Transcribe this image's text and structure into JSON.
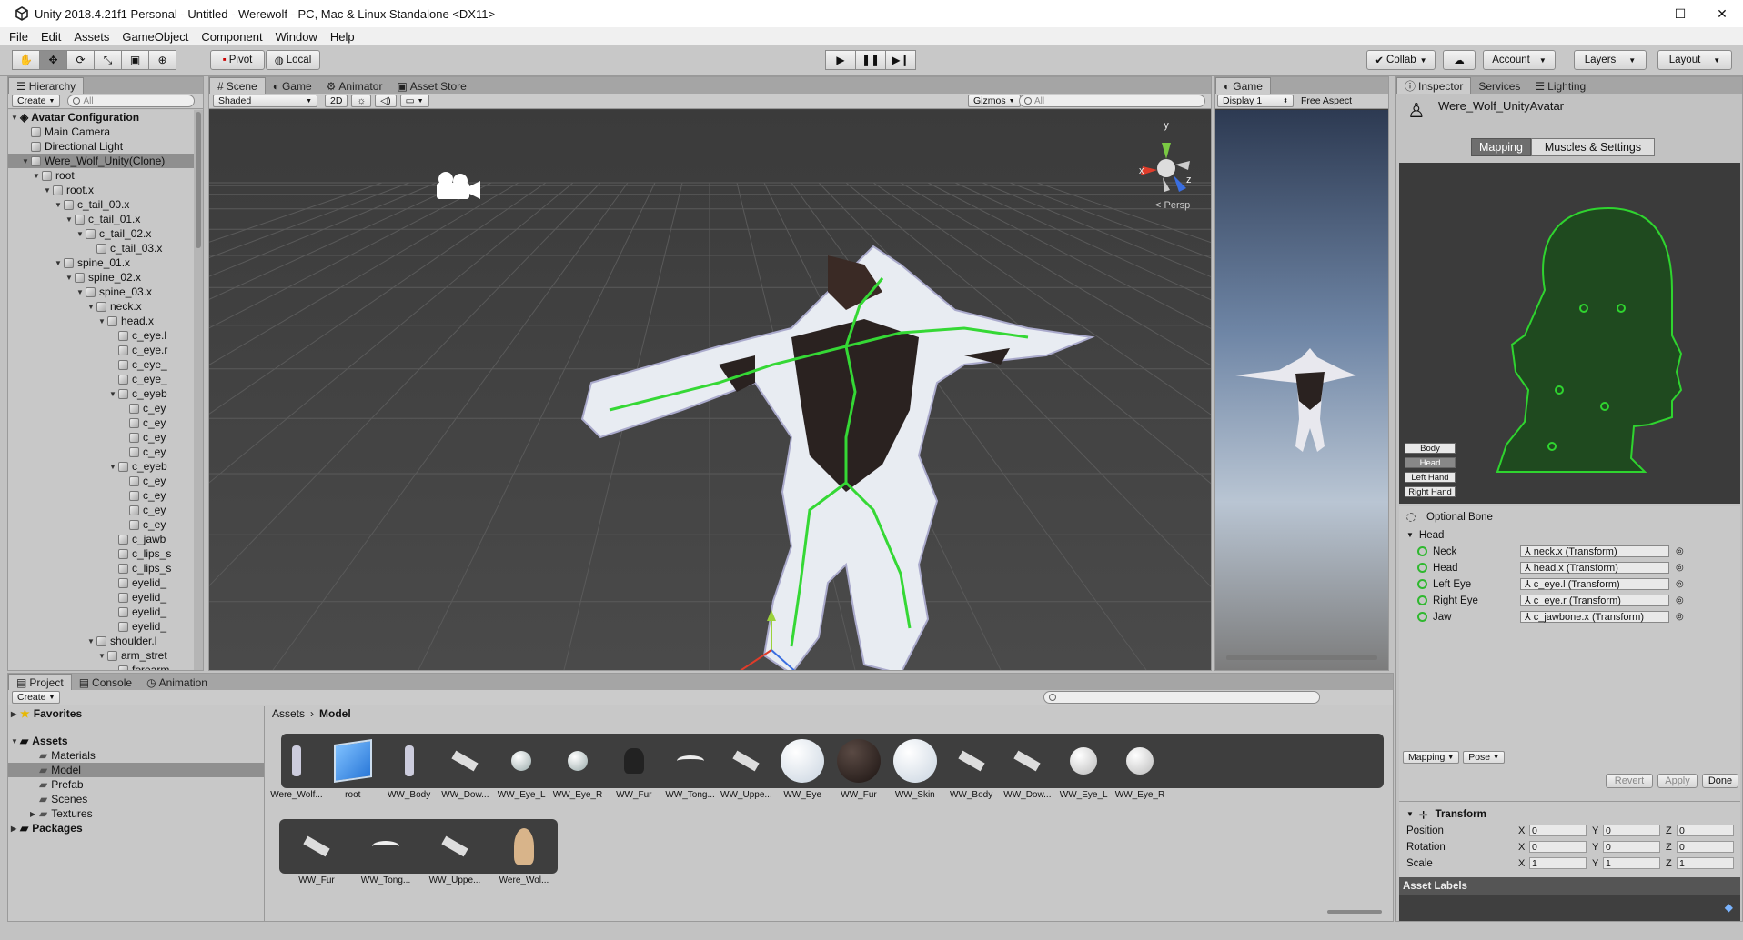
{
  "window": {
    "title": "Unity 2018.4.21f1 Personal - Untitled - Werewolf - PC, Mac & Linux Standalone <DX11>"
  },
  "menu": [
    "File",
    "Edit",
    "Assets",
    "GameObject",
    "Component",
    "Window",
    "Help"
  ],
  "toolbar": {
    "pivot": "Pivot",
    "local": "Local",
    "collab": "Collab",
    "account": "Account",
    "layers": "Layers",
    "layout": "Layout"
  },
  "hierarchy": {
    "tab": "Hierarchy",
    "create": "Create",
    "search_placeholder": "All",
    "scene_name": "Avatar Configuration",
    "rows": [
      {
        "label": "Main Camera",
        "indent": 1
      },
      {
        "label": "Directional Light",
        "indent": 1
      },
      {
        "label": "Were_Wolf_Unity(Clone)",
        "indent": 1
      },
      {
        "label": "root",
        "indent": 2
      },
      {
        "label": "root.x",
        "indent": 3
      },
      {
        "label": "c_tail_00.x",
        "indent": 4
      },
      {
        "label": "c_tail_01.x",
        "indent": 5
      },
      {
        "label": "c_tail_02.x",
        "indent": 6
      },
      {
        "label": "c_tail_03.x",
        "indent": 7
      },
      {
        "label": "spine_01.x",
        "indent": 4
      },
      {
        "label": "spine_02.x",
        "indent": 5
      },
      {
        "label": "spine_03.x",
        "indent": 6
      },
      {
        "label": "neck.x",
        "indent": 7
      },
      {
        "label": "head.x",
        "indent": 8
      },
      {
        "label": "c_eye.l",
        "indent": 9
      },
      {
        "label": "c_eye.r",
        "indent": 9
      },
      {
        "label": "c_eye_",
        "indent": 9
      },
      {
        "label": "c_eye_",
        "indent": 9
      },
      {
        "label": "c_eyeb",
        "indent": 9
      },
      {
        "label": "c_ey",
        "indent": 10
      },
      {
        "label": "c_ey",
        "indent": 10
      },
      {
        "label": "c_ey",
        "indent": 10
      },
      {
        "label": "c_ey",
        "indent": 10
      },
      {
        "label": "c_eyeb",
        "indent": 9
      },
      {
        "label": "c_ey",
        "indent": 10
      },
      {
        "label": "c_ey",
        "indent": 10
      },
      {
        "label": "c_ey",
        "indent": 10
      },
      {
        "label": "c_ey",
        "indent": 10
      },
      {
        "label": "c_jawb",
        "indent": 9
      },
      {
        "label": "c_lips_s",
        "indent": 9
      },
      {
        "label": "c_lips_s",
        "indent": 9
      },
      {
        "label": "eyelid_",
        "indent": 9
      },
      {
        "label": "eyelid_",
        "indent": 9
      },
      {
        "label": "eyelid_",
        "indent": 9
      },
      {
        "label": "eyelid_",
        "indent": 9
      },
      {
        "label": "shoulder.l",
        "indent": 7
      },
      {
        "label": "arm_stret",
        "indent": 8
      },
      {
        "label": "forearm",
        "indent": 9
      }
    ]
  },
  "scene": {
    "tabs": [
      "Scene",
      "Game",
      "Animator",
      "Asset Store"
    ],
    "shading": "Shaded",
    "mode2d": "2D",
    "gizmos": "Gizmos",
    "search_placeholder": "All",
    "persp": "Persp",
    "axis_y": "y",
    "axis_x": "x",
    "axis_z": "z"
  },
  "game": {
    "tab": "Game",
    "display": "Display 1",
    "aspect": "Free Aspect"
  },
  "inspector": {
    "tabs": [
      "Inspector",
      "Services",
      "Lighting"
    ],
    "object_name": "Were_Wolf_UnityAvatar",
    "mapping_tab": "Mapping",
    "muscles_tab": "Muscles & Settings",
    "body_buttons": [
      "Body",
      "Head",
      "Left Hand",
      "Right Hand"
    ],
    "optional_bone": "Optional Bone",
    "group": "Head",
    "bones": [
      {
        "label": "Neck",
        "value": "neck.x (Transform)"
      },
      {
        "label": "Head",
        "value": "head.x (Transform)"
      },
      {
        "label": "Left Eye",
        "value": "c_eye.l (Transform)"
      },
      {
        "label": "Right Eye",
        "value": "c_eye.r (Transform)"
      },
      {
        "label": "Jaw",
        "value": "c_jawbone.x (Transform)"
      }
    ],
    "mapping_dd": "Mapping",
    "pose_dd": "Pose",
    "revert": "Revert",
    "apply": "Apply",
    "done": "Done",
    "transform": {
      "title": "Transform",
      "rows": [
        {
          "label": "Position",
          "x": "0",
          "y": "0",
          "z": "0"
        },
        {
          "label": "Rotation",
          "x": "0",
          "y": "0",
          "z": "0"
        },
        {
          "label": "Scale",
          "x": "1",
          "y": "1",
          "z": "1"
        }
      ]
    },
    "asset_labels": "Asset Labels"
  },
  "project": {
    "tabs": [
      "Project",
      "Console",
      "Animation"
    ],
    "create": "Create",
    "favorites": "Favorites",
    "assets": "Assets",
    "folders": [
      "Materials",
      "Model",
      "Prefab",
      "Scenes",
      "Textures"
    ],
    "packages": "Packages",
    "breadcrumb": [
      "Assets",
      "Model"
    ],
    "row1": [
      "Were_Wolf...",
      "root",
      "WW_Body",
      "WW_Dow...",
      "WW_Eye_L",
      "WW_Eye_R",
      "WW_Fur",
      "WW_Tong...",
      "WW_Uppe...",
      "WW_Eye",
      "WW_Fur",
      "WW_Skin",
      "WW_Body",
      "WW_Dow...",
      "WW_Eye_L",
      "WW_Eye_R"
    ],
    "row2": [
      "WW_Fur",
      "WW_Tong...",
      "WW_Uppe...",
      "Were_Wol..."
    ]
  },
  "colors": {
    "accent_green": "#2fd42f",
    "head_fill": "#1f4a1f"
  }
}
